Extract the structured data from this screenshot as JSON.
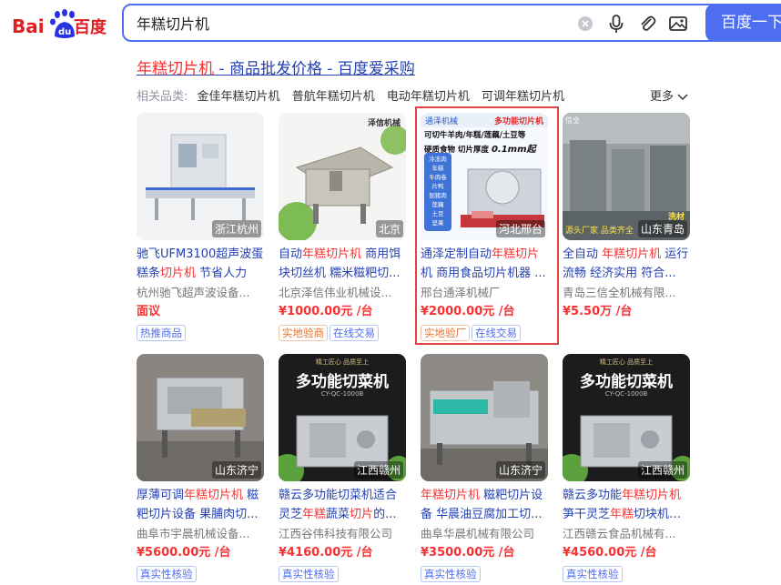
{
  "header": {
    "logo_text": "Bai du 百度",
    "search_value": "年糕切片机",
    "search_button": "百度一下"
  },
  "result": {
    "title_highlight": "年糕切片机",
    "title_rest": " - 商品批发价格 - 百度爱采购"
  },
  "related": {
    "label": "相关品类:",
    "links": [
      "金佳年糕切片机",
      "普航年糕切片机",
      "电动年糕切片机",
      "可调年糕切片机"
    ],
    "more": "更多"
  },
  "products": [
    {
      "title_parts": [
        [
          "驰飞UFM3100超声波蛋糕条",
          false
        ],
        [
          "切片机",
          true
        ],
        [
          " 节省人力",
          false
        ]
      ],
      "company": "杭州驰飞超声波设备...",
      "price": "面议",
      "location": "浙江杭州",
      "badges": [
        [
          "热推商品",
          "blue"
        ]
      ]
    },
    {
      "title_parts": [
        [
          "自动",
          false
        ],
        [
          "年糕切片机",
          true
        ],
        [
          " 商用饵块切丝机 糯米糍粑切...",
          false
        ]
      ],
      "company": "北京泽信伟业机械设...",
      "price": "¥1000.00元 /台",
      "location": "北京",
      "image_text": "泽信机械",
      "badges": [
        [
          "实地验商",
          "orange"
        ],
        [
          "在线交易",
          "blue"
        ]
      ]
    },
    {
      "title_parts": [
        [
          "通泽定制自动",
          false
        ],
        [
          "年糕切片",
          true
        ],
        [
          "机 商用食品切片机器 ...",
          false
        ]
      ],
      "company": "邢台通泽机械厂",
      "price": "¥2000.00元 /台",
      "location": "河北邢台",
      "image_text": {
        "brand": "通泽机械",
        "tag": "多功能切片机",
        "line1": "可切牛羊肉/年糕/莲藕/土豆等",
        "line2": "硬质食物 切片厚度",
        "thickness": "0.1mm起",
        "features": [
          "冷冻肉",
          "年糕",
          "牛肉卷",
          "片鸭",
          "刨猪肉",
          "莲藕",
          "土豆",
          "坚果"
        ]
      },
      "badges": [
        [
          "实地验厂",
          "orange"
        ],
        [
          "在线交易",
          "blue"
        ]
      ]
    },
    {
      "title_parts": [
        [
          "全自动 ",
          false
        ],
        [
          "年糕切片机",
          true
        ],
        [
          " 运行流畅 经济实用 符合...",
          false
        ]
      ],
      "company": "青岛三信全机械有限...",
      "price": "¥5.50万 /台",
      "location": "山东青岛",
      "image_text": {
        "top": "信全",
        "source": "源头厂家 品类齐全",
        "stamp": "洗材"
      },
      "badges": []
    },
    {
      "title_parts": [
        [
          "厚薄可调",
          false
        ],
        [
          "年糕切片机",
          true
        ],
        [
          " 糍粑切片设备 果脯肉切...",
          false
        ]
      ],
      "company": "曲阜市宇晨机械设备...",
      "price": "¥5600.00元 /台",
      "location": "山东济宁",
      "badges": [
        [
          "真实性核验",
          "blue"
        ]
      ]
    },
    {
      "title_parts": [
        [
          "赣云多功能切菜机适合灵芝",
          false
        ],
        [
          "年糕",
          true
        ],
        [
          "蔬菜",
          false
        ],
        [
          "切片",
          true
        ],
        [
          "的...",
          false
        ]
      ],
      "company": "江西谷伟科技有限公司",
      "price": "¥4160.00元 /台",
      "location": "江西赣州",
      "image_text": {
        "slogan": "精工匠心 品质至上",
        "title": "多功能切菜机",
        "model": "CY-QC-1000B"
      },
      "badges": [
        [
          "真实性核验",
          "blue"
        ]
      ]
    },
    {
      "title_parts": [
        [
          "年糕切片机",
          true
        ],
        [
          " 糍粑切片设备 华晨油豆腐加工切...",
          false
        ]
      ],
      "company": "曲阜华晨机械有限公司",
      "price": "¥3500.00元 /台",
      "location": "山东济宁",
      "badges": [
        [
          "真实性核验",
          "blue"
        ]
      ]
    },
    {
      "title_parts": [
        [
          "赣云多功能",
          false
        ],
        [
          "年糕切片机",
          true
        ],
        [
          " 笋干灵芝",
          false
        ],
        [
          "年糕",
          true
        ],
        [
          "切块机器 ...",
          false
        ]
      ],
      "company": "江西赣云食品机械有...",
      "price": "¥4560.00元 /台",
      "location": "江西赣州",
      "image_text": {
        "slogan": "精工匠心 品质至上",
        "title": "多功能切菜机",
        "model": "CY-QC-1000B"
      },
      "badges": [
        [
          "真实性核验",
          "blue"
        ]
      ]
    }
  ],
  "colors": {
    "brand_blue": "#4e6ef2",
    "link_blue": "#2440b3",
    "highlight_red": "#f73131",
    "logo_red": "#de1e20",
    "logo_blue": "#2932e1",
    "frame_red": "#e0443f"
  },
  "icons": [
    "clear-icon",
    "microphone-icon",
    "attachment-icon",
    "image-search-icon",
    "chevron-down-icon",
    "paw-icon"
  ]
}
